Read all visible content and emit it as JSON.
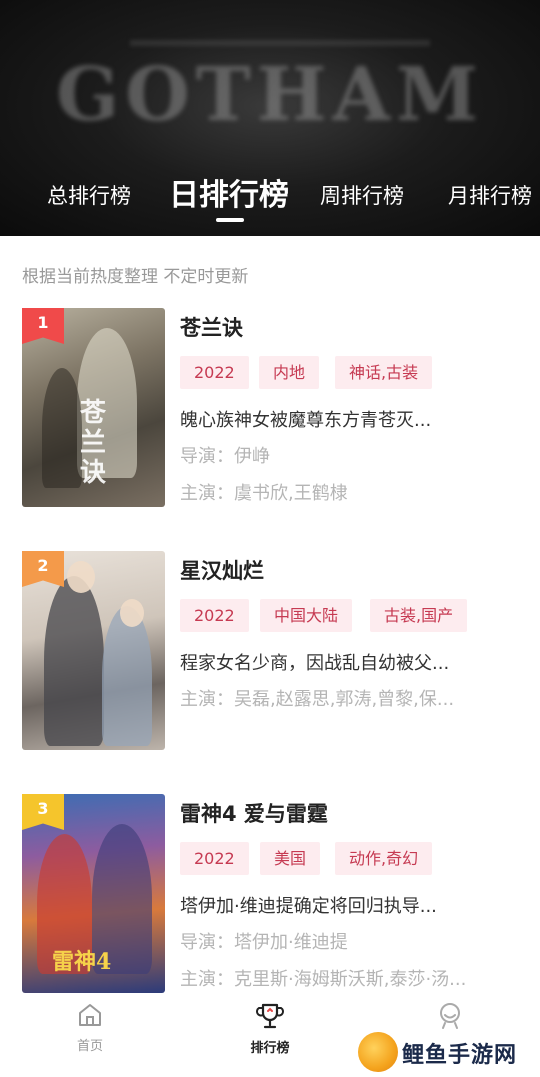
{
  "banner": {
    "text": "GOTHAM"
  },
  "tabs": [
    {
      "label": "总排行榜",
      "active": false
    },
    {
      "label": "日排行榜",
      "active": true
    },
    {
      "label": "周排行榜",
      "active": false
    },
    {
      "label": "月排行榜",
      "active": false
    }
  ],
  "subtitle": "根据当前热度整理 不定时更新",
  "items": [
    {
      "rank": "1",
      "title": "苍兰诀",
      "tags": [
        "2022",
        "内地",
        "神话,古装"
      ],
      "description": "魄心族神女被魔尊东方青苍灭...",
      "director": "导演：伊峥",
      "cast": "主演：虞书欣,王鹤棣",
      "poster_art": "苍兰诀"
    },
    {
      "rank": "2",
      "title": "星汉灿烂",
      "tags": [
        "2022",
        "中国大陆",
        "古装,国产"
      ],
      "description": "程家女名少商，因战乱自幼被父...",
      "cast": "主演：吴磊,赵露思,郭涛,曾黎,保..."
    },
    {
      "rank": "3",
      "title": "雷神4 爱与雷霆",
      "tags": [
        "2022",
        "美国",
        "动作,奇幻"
      ],
      "description": "塔伊加·维迪提确定将回归执导...",
      "director": "导演：塔伊加·维迪提",
      "cast": "主演：克里斯·海姆斯沃斯,泰莎·汤...",
      "poster_art": "雷神4"
    }
  ],
  "bottom_nav": [
    {
      "label": "首页",
      "icon": "home-icon",
      "active": false
    },
    {
      "label": "排行榜",
      "icon": "trophy-icon",
      "active": true
    },
    {
      "label": "",
      "icon": "profile-icon",
      "active": false
    }
  ],
  "watermark": {
    "text": "鲤鱼手游网"
  },
  "colors": {
    "accent": "#c63a52",
    "tag_bg": "#fdecef",
    "rank1": "#f04a4a",
    "rank2": "#f49a4a",
    "rank3": "#f5c52c"
  }
}
